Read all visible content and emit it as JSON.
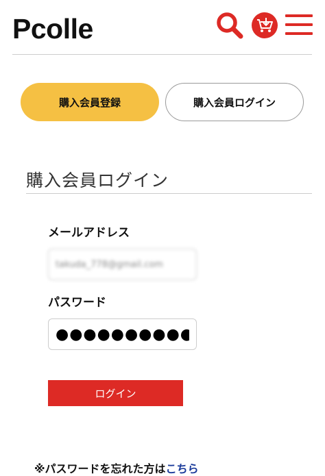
{
  "header": {
    "logo": "Pcolle",
    "search_icon": "search-icon",
    "cart_icon": "cart-icon",
    "menu_icon": "hamburger-menu-icon",
    "accent_color": "#dd2a25"
  },
  "tabs": {
    "register_label": "購入会員登録",
    "login_label": "購入会員ログイン",
    "register_color": "#f5c043"
  },
  "login_form": {
    "title": "購入会員ログイン",
    "email_label": "メールアドレス",
    "email_value": "takuda_778@gmail.com",
    "password_label": "パスワード",
    "password_value": "●●●●●●●●●●●●●●",
    "submit_label": "ログイン"
  },
  "forgot": {
    "text": "※パスワードを忘れた方は",
    "link": "こちら"
  }
}
